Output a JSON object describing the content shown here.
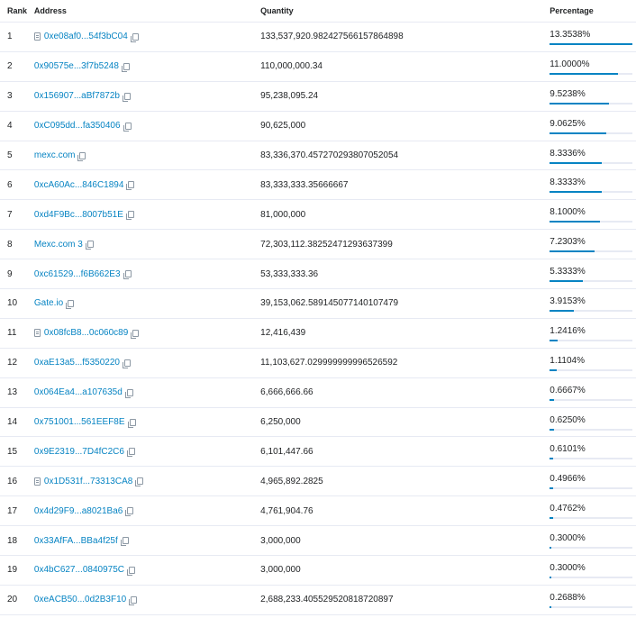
{
  "header": {
    "rank": "Rank",
    "address": "Address",
    "quantity": "Quantity",
    "percentage": "Percentage"
  },
  "rows": [
    {
      "rank": "1",
      "address": "0xe08af0...54f3bC04",
      "contract": true,
      "quantity": "133,537,920.982427566157864898",
      "percentage": "13.3538%",
      "pct": 0.133538
    },
    {
      "rank": "2",
      "address": "0x90575e...3f7b5248",
      "contract": false,
      "quantity": "110,000,000.34",
      "percentage": "11.0000%",
      "pct": 0.11
    },
    {
      "rank": "3",
      "address": "0x156907...aBf7872b",
      "contract": false,
      "quantity": "95,238,095.24",
      "percentage": "9.5238%",
      "pct": 0.095238
    },
    {
      "rank": "4",
      "address": "0xC095dd...fa350406",
      "contract": false,
      "quantity": "90,625,000",
      "percentage": "9.0625%",
      "pct": 0.090625
    },
    {
      "rank": "5",
      "address": "mexc.com",
      "contract": false,
      "quantity": "83,336,370.457270293807052054",
      "percentage": "8.3336%",
      "pct": 0.083336
    },
    {
      "rank": "6",
      "address": "0xcA60Ac...846C1894",
      "contract": false,
      "quantity": "83,333,333.35666667",
      "percentage": "8.3333%",
      "pct": 0.083333
    },
    {
      "rank": "7",
      "address": "0xd4F9Bc...8007b51E",
      "contract": false,
      "quantity": "81,000,000",
      "percentage": "8.1000%",
      "pct": 0.081
    },
    {
      "rank": "8",
      "address": "Mexc.com 3",
      "contract": false,
      "quantity": "72,303,112.38252471293637399",
      "percentage": "7.2303%",
      "pct": 0.072303
    },
    {
      "rank": "9",
      "address": "0xc61529...f6B662E3",
      "contract": false,
      "quantity": "53,333,333.36",
      "percentage": "5.3333%",
      "pct": 0.053333
    },
    {
      "rank": "10",
      "address": "Gate.io",
      "contract": false,
      "quantity": "39,153,062.589145077140107479",
      "percentage": "3.9153%",
      "pct": 0.039153
    },
    {
      "rank": "11",
      "address": "0x08fcB8...0c060c89",
      "contract": true,
      "quantity": "12,416,439",
      "percentage": "1.2416%",
      "pct": 0.012416
    },
    {
      "rank": "12",
      "address": "0xaE13a5...f5350220",
      "contract": false,
      "quantity": "11,103,627.029999999996526592",
      "percentage": "1.1104%",
      "pct": 0.011104
    },
    {
      "rank": "13",
      "address": "0x064Ea4...a107635d",
      "contract": false,
      "quantity": "6,666,666.66",
      "percentage": "0.6667%",
      "pct": 0.006667
    },
    {
      "rank": "14",
      "address": "0x751001...561EEF8E",
      "contract": false,
      "quantity": "6,250,000",
      "percentage": "0.6250%",
      "pct": 0.00625
    },
    {
      "rank": "15",
      "address": "0x9E2319...7D4fC2C6",
      "contract": false,
      "quantity": "6,101,447.66",
      "percentage": "0.6101%",
      "pct": 0.006101
    },
    {
      "rank": "16",
      "address": "0x1D531f...73313CA8",
      "contract": true,
      "quantity": "4,965,892.2825",
      "percentage": "0.4966%",
      "pct": 0.004966
    },
    {
      "rank": "17",
      "address": "0x4d29F9...a8021Ba6",
      "contract": false,
      "quantity": "4,761,904.76",
      "percentage": "0.4762%",
      "pct": 0.004762
    },
    {
      "rank": "18",
      "address": "0x33AfFA...BBa4f25f",
      "contract": false,
      "quantity": "3,000,000",
      "percentage": "0.3000%",
      "pct": 0.003
    },
    {
      "rank": "19",
      "address": "0x4bC627...0840975C",
      "contract": false,
      "quantity": "3,000,000",
      "percentage": "0.3000%",
      "pct": 0.003
    },
    {
      "rank": "20",
      "address": "0xeACB50...0d2B3F10",
      "contract": false,
      "quantity": "2,688,233.405529520818720897",
      "percentage": "0.2688%",
      "pct": 0.002688
    }
  ],
  "colors": {
    "link": "#0784c3",
    "bar": "#0784c3",
    "track": "#e7eaf3"
  }
}
